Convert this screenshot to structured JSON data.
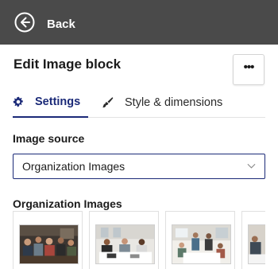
{
  "header": {
    "back_label": "Back"
  },
  "panel": {
    "title": "Edit Image block",
    "more_label": "•••"
  },
  "tabs": [
    {
      "label": "Settings"
    },
    {
      "label": "Style & dimensions"
    }
  ],
  "form": {
    "image_source_label": "Image source",
    "image_source_value": "Organization Images",
    "gallery_label": "Organization Images"
  },
  "colors": {
    "header_bg": "#4a4a4a",
    "accent": "#1b2a78"
  }
}
